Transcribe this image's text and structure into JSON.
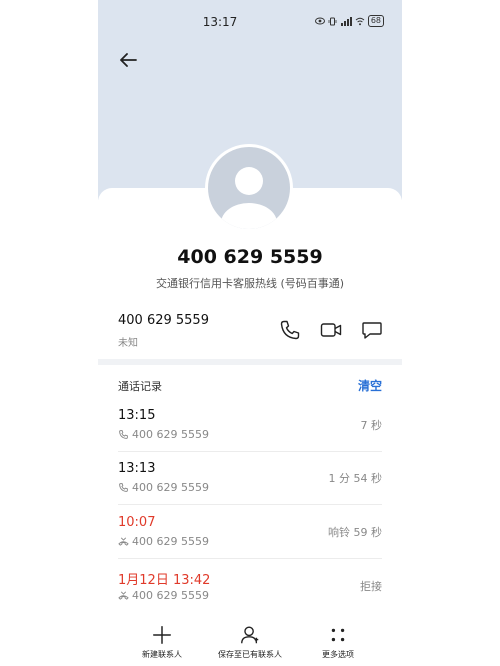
{
  "status_bar": {
    "time": "13:17",
    "battery": "68"
  },
  "contact": {
    "number": "400 629 5559",
    "label": "交通银行信用卡客服热线 (号码百事通)"
  },
  "number_row": {
    "number": "400 629 5559",
    "location": "未知"
  },
  "call_log": {
    "title": "通话记录",
    "clear_label": "清空",
    "entries": [
      {
        "time": "13:15",
        "number": "400 629 5559",
        "status": "7 秒",
        "type": "outgoing"
      },
      {
        "time": "13:13",
        "number": "400 629 5559",
        "status": "1 分 54 秒",
        "type": "outgoing"
      },
      {
        "time": "10:07",
        "number": "400 629 5559",
        "status": "响铃 59 秒",
        "type": "missed"
      },
      {
        "time": "1月12日 13:42",
        "number": "400 629 5559",
        "status": "拒接",
        "type": "missed"
      }
    ]
  },
  "bottom_bar": {
    "new_contact": "新建联系人",
    "save_existing": "保存至已有联系人",
    "more": "更多选项"
  },
  "colors": {
    "header_bg": "#dce4ef",
    "accent": "#2970d6",
    "missed": "#e03a2a"
  }
}
